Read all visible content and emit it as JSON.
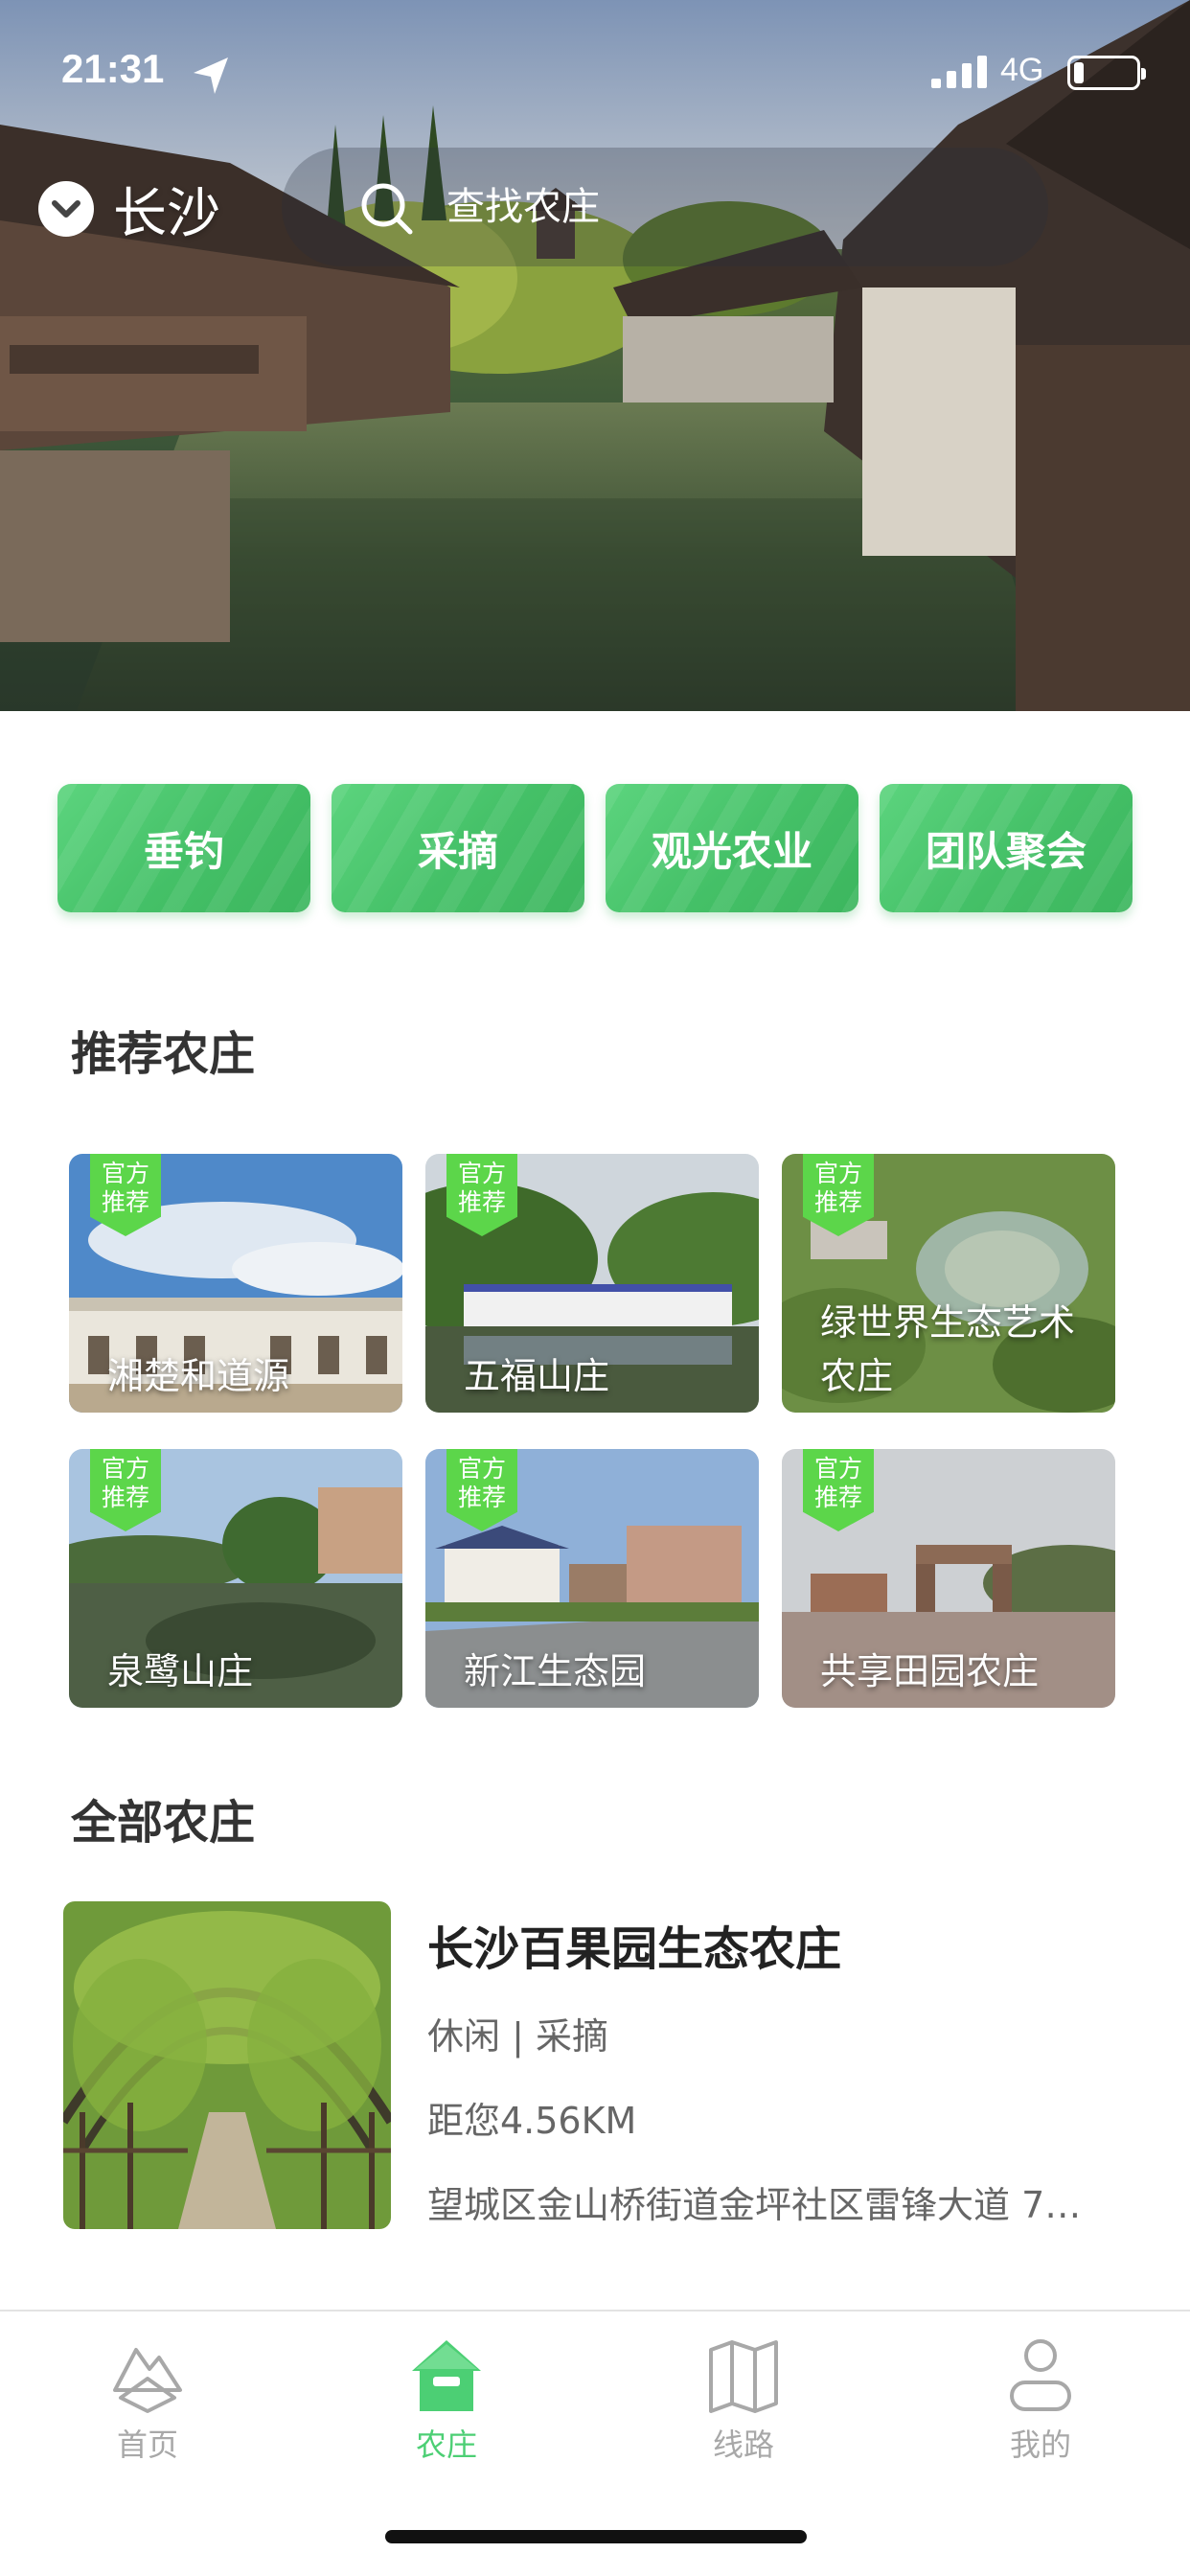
{
  "status_bar": {
    "time": "21:31",
    "network": "4G"
  },
  "header": {
    "city": "长沙",
    "search_placeholder": "查找农庄"
  },
  "categories": [
    {
      "label": "垂钓"
    },
    {
      "label": "采摘"
    },
    {
      "label": "观光农业"
    },
    {
      "label": "团队聚会"
    }
  ],
  "recommended": {
    "title": "推荐农庄",
    "badge_label": "官方推荐",
    "items": [
      {
        "name": "湘楚和道源"
      },
      {
        "name": "五福山庄"
      },
      {
        "name": "绿世界生态艺术农庄"
      },
      {
        "name": "泉鹭山庄"
      },
      {
        "name": "新江生态园"
      },
      {
        "name": "共享田园农庄"
      }
    ]
  },
  "all_farms": {
    "title": "全部农庄",
    "items": [
      {
        "name": "长沙百果园生态农庄",
        "tags": "休闲 | 采摘",
        "distance": "距您4.56KM",
        "address": "望城区金山桥街道金坪社区雷锋大道 7…"
      }
    ]
  },
  "tab_bar": {
    "items": [
      {
        "label": "首页",
        "icon": "home-mountain-icon"
      },
      {
        "label": "农庄",
        "icon": "farmhouse-icon"
      },
      {
        "label": "线路",
        "icon": "map-icon"
      },
      {
        "label": "我的",
        "icon": "user-icon"
      }
    ],
    "active_color": "#4ccf74",
    "inactive_color": "#a8a8a8"
  },
  "colors": {
    "brand_green": "#4cc46e",
    "badge_green": "#5cd64a"
  }
}
